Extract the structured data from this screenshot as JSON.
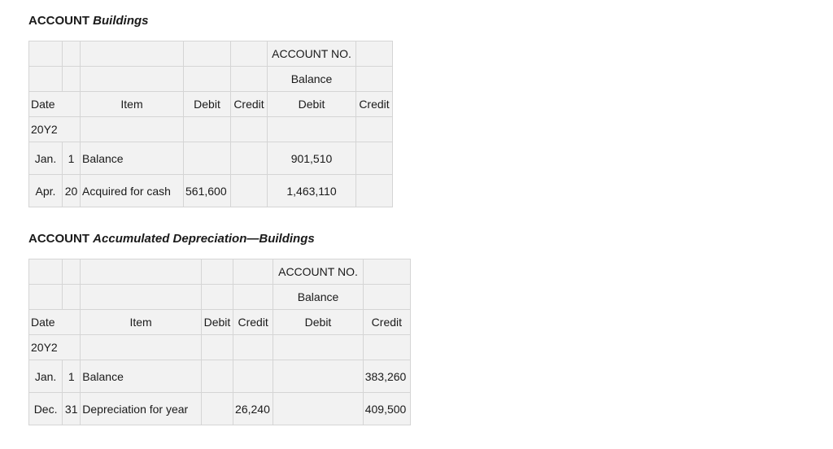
{
  "accounts": [
    {
      "prefix": "ACCOUNT",
      "name": "Buildings",
      "account_no_label": "ACCOUNT NO.",
      "balance_label": "Balance",
      "headers": {
        "date": "Date",
        "item": "Item",
        "debit": "Debit",
        "credit": "Credit",
        "bal_debit": "Debit",
        "bal_credit": "Credit"
      },
      "year": "20Y2",
      "rows": [
        {
          "month": "Jan.",
          "day": "1",
          "item": "Balance",
          "debit": "",
          "credit": "",
          "bal_debit": "901,510",
          "bal_credit": ""
        },
        {
          "month": "Apr.",
          "day": "20",
          "item": "Acquired for cash",
          "debit": "561,600",
          "credit": "",
          "bal_debit": "1,463,110",
          "bal_credit": ""
        }
      ]
    },
    {
      "prefix": "ACCOUNT",
      "name": "Accumulated Depreciation—Buildings",
      "account_no_label": "ACCOUNT NO.",
      "balance_label": "Balance",
      "headers": {
        "date": "Date",
        "item": "Item",
        "debit": "Debit",
        "credit": "Credit",
        "bal_debit": "Debit",
        "bal_credit": "Credit"
      },
      "year": "20Y2",
      "rows": [
        {
          "month": "Jan.",
          "day": "1",
          "item": "Balance",
          "debit": "",
          "credit": "",
          "bal_debit": "",
          "bal_credit": "383,260"
        },
        {
          "month": "Dec.",
          "day": "31",
          "item": "Depreciation for year",
          "debit": "",
          "credit": "26,240",
          "bal_debit": "",
          "bal_credit": "409,500"
        }
      ]
    }
  ]
}
